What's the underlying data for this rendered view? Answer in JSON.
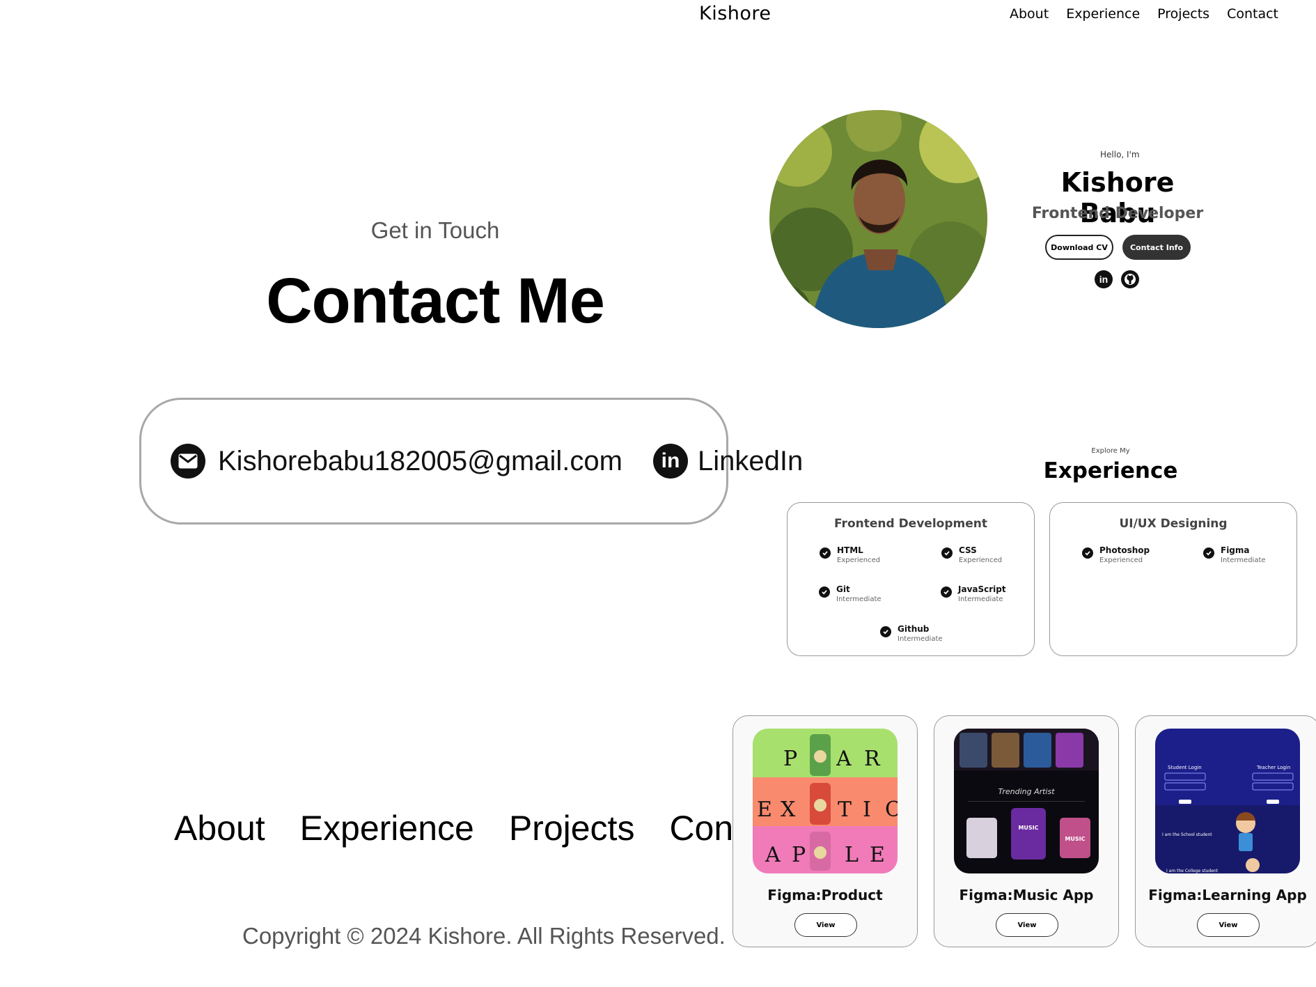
{
  "header": {
    "brand": "Kishore",
    "nav": [
      "About",
      "Experience",
      "Projects",
      "Contact"
    ]
  },
  "contact": {
    "subtitle": "Get in Touch",
    "title": "Contact Me",
    "email": "Kishorebabu182005@gmail.com",
    "linkedin": "LinkedIn"
  },
  "footer": {
    "nav": [
      "About",
      "Experience",
      "Projects",
      "Contact"
    ],
    "copyright": "Copyright © 2024 Kishore. All Rights Reserved."
  },
  "profile": {
    "greeting": "Hello, I'm",
    "name": "Kishore Babu",
    "role": "Frontend Developer",
    "download_cv": "Download CV",
    "contact_info": "Contact Info",
    "socials": [
      "linkedin-icon",
      "github-icon"
    ]
  },
  "experience": {
    "subtitle": "Explore My",
    "title": "Experience",
    "cards": [
      {
        "title": "Frontend Development",
        "skills": [
          {
            "name": "HTML",
            "level": "Experienced"
          },
          {
            "name": "CSS",
            "level": "Experienced"
          },
          {
            "name": "Git",
            "level": "Intermediate"
          },
          {
            "name": "JavaScript",
            "level": "Intermediate"
          },
          {
            "name": "Github",
            "level": "Intermediate"
          }
        ]
      },
      {
        "title": "UI/UX Designing",
        "skills": [
          {
            "name": "Photoshop",
            "level": "Experienced"
          },
          {
            "name": "Figma",
            "level": "Intermediate"
          }
        ]
      }
    ]
  },
  "projects": [
    {
      "title": "Figma:Product",
      "button": "View",
      "image_text": [
        [
          "P",
          "A",
          "R"
        ],
        [
          "E",
          "X",
          "T",
          "I",
          "C"
        ],
        [
          "A",
          "P",
          "L",
          "E"
        ]
      ]
    },
    {
      "title": "Figma:Music App",
      "button": "View",
      "image_text": {
        "heading": "Trending Artist",
        "badge": "MUSIC",
        "tile": "MUSIC"
      }
    },
    {
      "title": "Figma:Learning App",
      "button": "View",
      "image_text": {
        "left": "Student Login",
        "right": "Teacher Login",
        "line1": "I am the School student",
        "line2": "I am the College student"
      }
    }
  ]
}
